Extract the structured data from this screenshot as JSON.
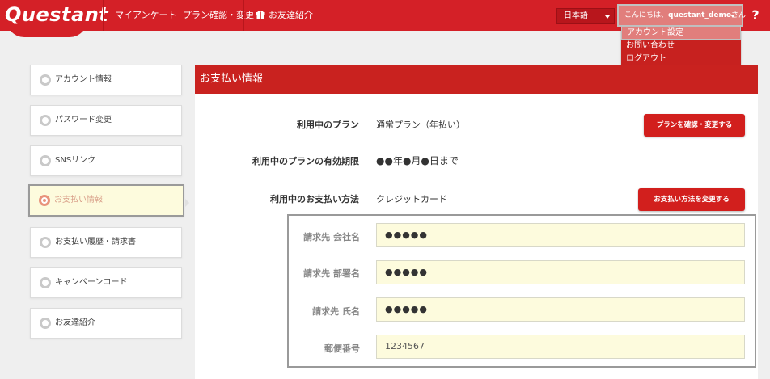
{
  "header": {
    "logo": "Questant",
    "nav": [
      "マイアンケート",
      "プラン確認・変更",
      "お友達紹介"
    ],
    "language": "日本語",
    "user_greeting": "こんにちは、",
    "user_name": "questant_demo",
    "user_suffix": "さん",
    "help": "?"
  },
  "dropdown": [
    "アカウント設定",
    "お問い合わせ",
    "ログアウト"
  ],
  "sidebar": {
    "items": [
      {
        "label": "アカウント情報"
      },
      {
        "label": "パスワード変更"
      },
      {
        "label": "SNSリンク"
      },
      {
        "label": "お支払い情報"
      },
      {
        "label": "お支払い履歴・請求書"
      },
      {
        "label": "キャンペーンコード"
      },
      {
        "label": "お友達紹介"
      }
    ],
    "active_index": 3
  },
  "main": {
    "title": "お支払い情報",
    "plan_label": "利用中のプラン",
    "plan_value": "通常プラン（年払い）",
    "plan_button": "プランを確認・変更する",
    "expiry_label": "利用中のプランの有効期限",
    "expiry_value": "●●年●月●日まで",
    "method_label": "利用中のお支払い方法",
    "method_value": "クレジットカード",
    "method_button": "お支払い方法を変更する"
  },
  "billing": {
    "company_label": "請求先 会社名",
    "company_value": "●●●●●",
    "dept_label": "請求先 部署名",
    "dept_value": "●●●●●",
    "name_label": "請求先 氏名",
    "name_value": "●●●●●",
    "zip_label": "郵便番号",
    "zip_value": "1234567"
  },
  "colors": {
    "brand_red": "#d42027",
    "active_bg": "#fdfbdd"
  }
}
